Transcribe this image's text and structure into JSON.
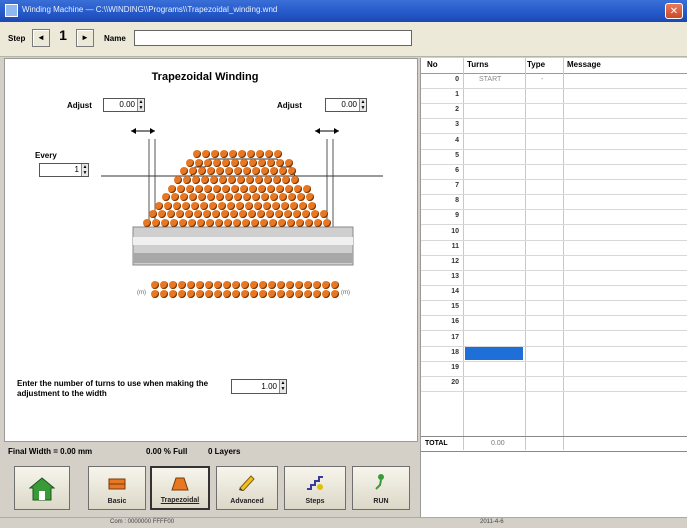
{
  "window": {
    "title": "Winding Machine — C:\\\\WINDING\\\\Programs\\\\Trapezoidal_winding.wnd"
  },
  "toolbar": {
    "step_label": "Step",
    "step_value": "1",
    "prev_symbol": "◄",
    "next_symbol": "►",
    "name_label": "Name",
    "name_value": ""
  },
  "diagram": {
    "title": "Trapezoidal Winding",
    "adjust_left_label": "Adjust",
    "adjust_left_value": "0.00",
    "adjust_right_label": "Adjust",
    "adjust_right_value": "0.00",
    "every_label": "Every",
    "every_value": "1",
    "turns_prompt": "Enter the number of turns to use when making the adjustment to the width",
    "turns_value": "1.00",
    "wire_color": "#e77722"
  },
  "status": {
    "final_width": "Final Width = 0.00 mm",
    "percent_full": "0.00 % Full",
    "layers": "0 Layers"
  },
  "buttons": [
    {
      "label": "",
      "icon": "house-icon"
    },
    {
      "label": "Basic",
      "icon": "coil-icon"
    },
    {
      "label": "Trapezoidal",
      "icon": "coil-trapezoid-icon"
    },
    {
      "label": "Advanced",
      "icon": "pencil-icon"
    },
    {
      "label": "Steps",
      "icon": "steps-icon"
    },
    {
      "label": "RUN",
      "icon": "run-icon"
    }
  ],
  "grid": {
    "headers": {
      "no": "No",
      "turns": "Turns",
      "type": "Type",
      "message": "Message"
    },
    "rows": [
      {
        "no": "0",
        "turns": "START",
        "type": "-"
      },
      {
        "no": "1"
      },
      {
        "no": "2"
      },
      {
        "no": "3"
      },
      {
        "no": "4"
      },
      {
        "no": "5"
      },
      {
        "no": "6"
      },
      {
        "no": "7"
      },
      {
        "no": "8"
      },
      {
        "no": "9"
      },
      {
        "no": "10"
      },
      {
        "no": "11"
      },
      {
        "no": "12"
      },
      {
        "no": "13"
      },
      {
        "no": "14"
      },
      {
        "no": "15"
      },
      {
        "no": "16"
      },
      {
        "no": "17"
      },
      {
        "no": "18"
      },
      {
        "no": "19"
      },
      {
        "no": "20"
      }
    ],
    "total_label": "TOTAL",
    "total_value": "0.00",
    "selected_row": "18"
  },
  "statusbar": {
    "left": "Com : 0000000 FFFF00",
    "right": "2011-4-6"
  }
}
